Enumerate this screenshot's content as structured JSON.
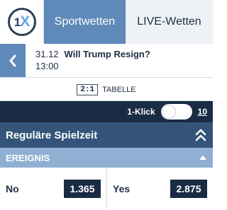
{
  "nav": {
    "logo_text_1": "1",
    "logo_text_x": "X",
    "tabs": [
      {
        "label": "Sportwetten",
        "active": true
      },
      {
        "label": "LIVE-Wetten",
        "active": false
      }
    ]
  },
  "event": {
    "back_icon": "chevron-left-icon",
    "date": "31.12",
    "title": "Will Trump Resign?",
    "time": "13:00"
  },
  "scoreboard": {
    "icon_text": "2:1",
    "label": "TABELLE"
  },
  "oneclick": {
    "label": "1-Klick",
    "enabled": false,
    "amount": "10"
  },
  "section": {
    "title": "Reguläre Spielzeit",
    "icon": "double-chevron-up-icon"
  },
  "market": {
    "title": "EREIGNIS",
    "icon": "chevron-up-icon",
    "outcomes": [
      {
        "name": "No",
        "odds": "1.365"
      },
      {
        "name": "Yes",
        "odds": "2.875"
      }
    ]
  },
  "colors": {
    "nav_active": "#5f89b8",
    "dark_navy": "#1a2b44",
    "section_blue": "#345579",
    "market_blue": "#8fb0d2"
  }
}
